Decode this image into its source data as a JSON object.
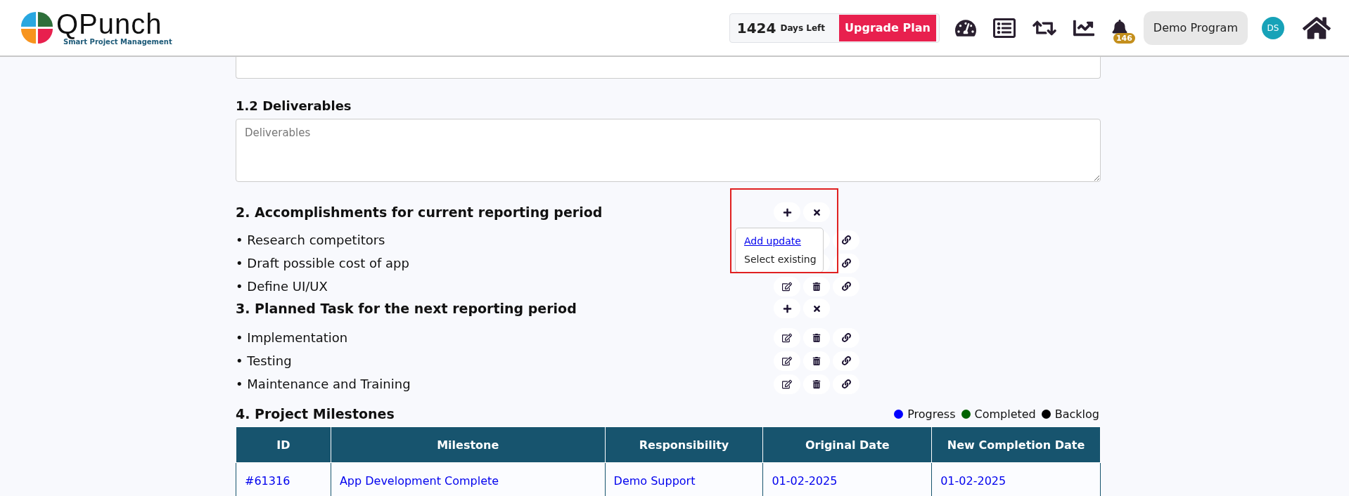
{
  "header": {
    "logo": {
      "name": "QPunch",
      "tagline": "Smart Project Management"
    },
    "days": {
      "count": "1424",
      "label": "Days Left"
    },
    "upgrade_button": "Upgrade Plan",
    "notifications": "146",
    "program": "Demo Program",
    "avatar": "DS"
  },
  "deliverables": {
    "title": "1.2 Deliverables",
    "placeholder": "Deliverables"
  },
  "sections": [
    {
      "title": "2. Accomplishments for current reporting period",
      "menu": [
        "Add update",
        "Select existing"
      ],
      "items": [
        "• Research competitors",
        "• Draft possible cost of app",
        "• Define UI/UX"
      ]
    },
    {
      "title": "3. Planned Task for the next reporting period",
      "items": [
        "• Implementation",
        "• Testing",
        "• Maintenance and Training"
      ]
    }
  ],
  "milestones": {
    "title": "4. Project Milestones",
    "legend": [
      {
        "label": "Progress",
        "color": "#0000ff"
      },
      {
        "label": "Completed",
        "color": "#006400"
      },
      {
        "label": "Backlog",
        "color": "#000000"
      }
    ],
    "columns": [
      "ID",
      "Milestone",
      "Responsibility",
      "Original Date",
      "New Completion Date"
    ],
    "rows": [
      [
        "#61316",
        "App Development Complete",
        "Demo Support",
        "01-02-2025",
        "01-02-2025"
      ]
    ]
  }
}
